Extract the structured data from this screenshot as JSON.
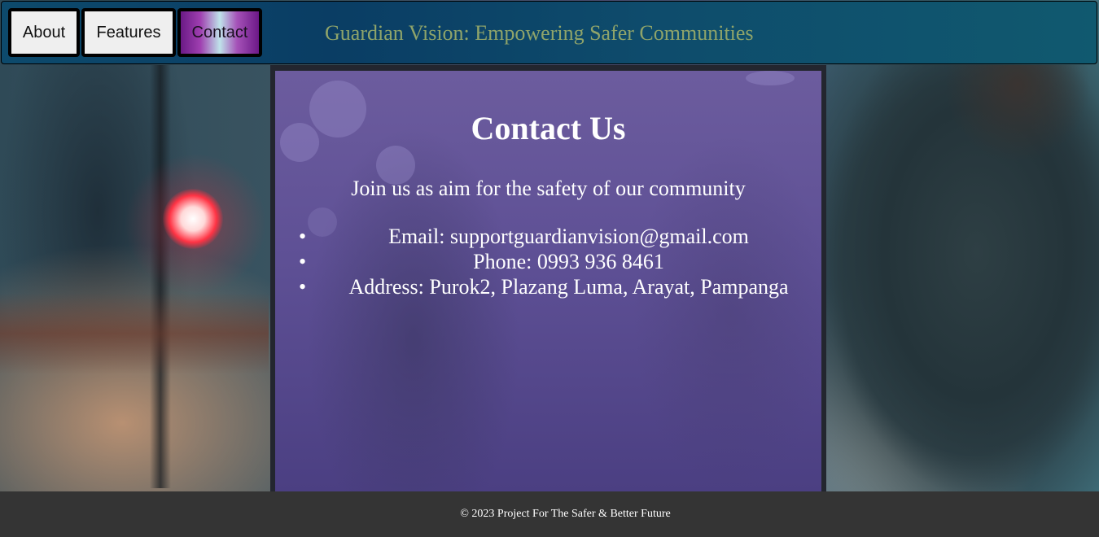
{
  "header": {
    "nav": [
      {
        "label": "About"
      },
      {
        "label": "Features"
      },
      {
        "label": "Contact"
      }
    ],
    "site_title": "Guardian Vision: Empowering Safer Communities"
  },
  "contact": {
    "title": "Contact Us",
    "tagline": "Join us as aim for the safety of our community",
    "items": [
      {
        "text": "Email: supportguardianvision@gmail.com"
      },
      {
        "text": "Phone: 0993 936 8461"
      },
      {
        "text": "Address: Purok2, Plazang Luma, Arayat, Pampanga"
      }
    ]
  },
  "footer": {
    "text": "© 2023 Project For The Safer & Better Future"
  },
  "colors": {
    "header_bg": "#0a3d64",
    "site_title": "#8fa46a",
    "card_bg": "#5e5095",
    "footer_bg": "#343434",
    "active_nav_accent": "#9f3fb0"
  }
}
